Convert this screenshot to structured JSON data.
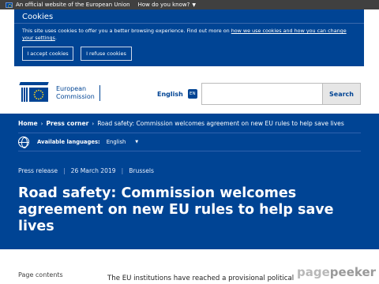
{
  "official_bar": {
    "text": "An official website of the European Union",
    "know_link": "How do you know?"
  },
  "cookie": {
    "title": "Cookies",
    "text_before": "This site uses cookies to offer you a better browsing experience. Find out more on ",
    "link": "how we use cookies and how you can change your settings",
    "text_after": ".",
    "accept_label": "I accept cookies",
    "refuse_label": "I refuse cookies"
  },
  "header": {
    "logo_line1": "European",
    "logo_line2": "Commission",
    "language": "English",
    "language_code": "EN",
    "search_placeholder": "",
    "search_label": "Search"
  },
  "breadcrumb": {
    "home": "Home",
    "press_corner": "Press corner",
    "current": "Road safety: Commission welcomes agreement on new EU rules to help save lives"
  },
  "languages": {
    "label": "Available languages:",
    "current": "English"
  },
  "meta": {
    "type": "Press release",
    "date": "26 March 2019",
    "place": "Brussels"
  },
  "title": "Road safety: Commission welcomes agreement on new EU rules to help save lives",
  "content": {
    "page_contents": "Page contents",
    "body_start": "The EU institutions have reached a provisional political"
  },
  "watermark": {
    "part1": "page",
    "part2": "peeker"
  },
  "colors": {
    "eu_blue": "#004494",
    "dark_bar": "#404040"
  }
}
